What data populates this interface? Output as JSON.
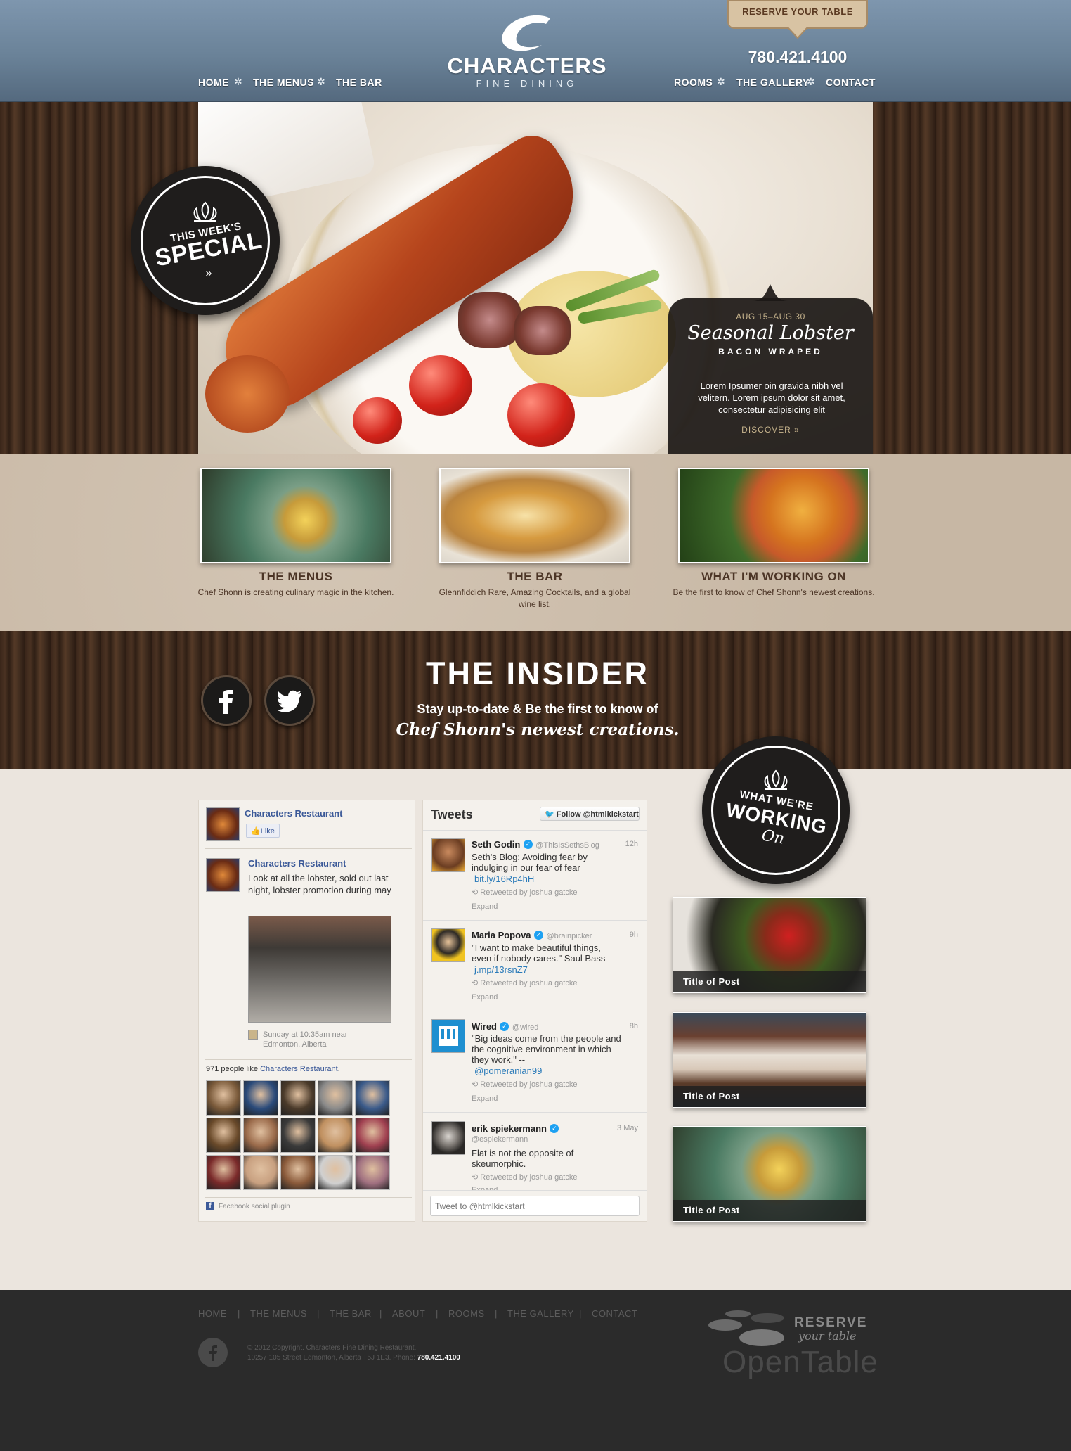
{
  "header": {
    "nav_left": [
      "HOME",
      "THE MENUS",
      "THE BAR"
    ],
    "nav_right": [
      "ROOMS",
      "THE GALLERY",
      "CONTACT"
    ],
    "logo_name": "CHARACTERS",
    "logo_sub": "FINE DINING",
    "reserve": "RESERVE YOUR TABLE",
    "phone": "780.421.4100"
  },
  "hero": {
    "badge_line1": "THIS WEEK'S",
    "badge_line2": "SPECIAL",
    "badge_arrow": "»",
    "date": "AUG 15–AUG 30",
    "title": "Seasonal Lobster",
    "subtitle": "BACON WRAPED",
    "description": "Lorem Ipsumer oin gravida nibh vel velitern. Lorem ipsum dolor sit amet, consectetur adipisicing elit",
    "cta": "DISCOVER »"
  },
  "features": [
    {
      "title": "THE MENUS",
      "desc": "Chef Shonn is creating culinary magic in the kitchen."
    },
    {
      "title": "THE BAR",
      "desc": "Glennfiddich Rare, Amazing Cocktails, and a global wine list."
    },
    {
      "title": "WHAT I'M WORKING ON",
      "desc": "Be the first to know of Chef Shonn's newest creations."
    }
  ],
  "insider": {
    "title": "THE INSIDER",
    "line1": "Stay up-to-date & Be the first to know of",
    "line2": "Chef Shonn's newest creations."
  },
  "working_badge": {
    "line1": "WHAT WE'RE",
    "line2": "WORKING",
    "line3": "On"
  },
  "facebook": {
    "page_name": "Characters Restaurant",
    "like": "Like",
    "post_author": "Characters Restaurant",
    "post_text": "Look at all the lobster, sold out last night, lobster promotion during may",
    "post_meta_1": "Sunday at 10:35am near",
    "post_meta_2": "Edmonton, Alberta",
    "likes_prefix": "971 people like ",
    "likes_page": "Characters Restaurant",
    "likes_suffix": ".",
    "plugin": "Facebook social plugin"
  },
  "twitter": {
    "title": "Tweets",
    "follow": "Follow @htmlkickstart",
    "compose_placeholder": "Tweet to @htmlkickstart",
    "tweets": [
      {
        "name": "Seth Godin",
        "handle": "@ThisIsSethsBlog",
        "time": "12h",
        "text": "Seth's Blog: Avoiding fear by indulging in our fear of fear",
        "link": "bit.ly/16Rp4hH",
        "retweet": "Retweeted by joshua gatcke",
        "expand": "Expand"
      },
      {
        "name": "Maria Popova",
        "handle": "@brainpicker",
        "time": "9h",
        "text": "\"I want to make beautiful things, even if nobody cares.\" Saul Bass",
        "link": "j.mp/13rsnZ7",
        "retweet": "Retweeted by joshua gatcke",
        "expand": "Expand"
      },
      {
        "name": "Wired",
        "handle": "@wired",
        "time": "8h",
        "text": "\"Big ideas come from the people and the cognitive environment in which they work.\" --",
        "link": "@pomeranian99",
        "retweet": "Retweeted by joshua gatcke",
        "expand": "Expand"
      },
      {
        "name": "erik spiekermann",
        "handle": "@espiekermann",
        "time": "3 May",
        "text": "Flat is not the opposite of skeumorphic.",
        "link": "",
        "retweet": "Retweeted by joshua gatcke",
        "expand": "Expand"
      }
    ]
  },
  "posts": [
    "Title of Post",
    "Title of Post",
    "Title of Post"
  ],
  "footer": {
    "nav": [
      "HOME",
      "THE MENUS",
      "THE BAR",
      "ABOUT",
      "ROOMS",
      "THE GALLERY",
      "CONTACT"
    ],
    "copyright": "© 2012 Copyright. Characters Fine Dining Restaurant.",
    "address": "10257 105 Street Edmonton, Alberta T5J 1E3. Phone:",
    "phone": "780.421.4100",
    "ot_title": "RESERVE",
    "ot_sub": "your table",
    "ot_word": "OpenTable"
  },
  "colors": {
    "header_blue": "#6a8298",
    "wood": "#3a261a",
    "paper": "#ebe5de",
    "footer": "#2b2b2b",
    "link_blue": "#3b5998"
  }
}
